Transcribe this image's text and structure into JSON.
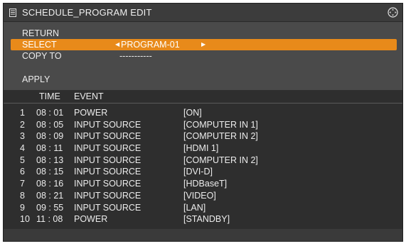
{
  "title": "SCHEDULE_PROGRAM EDIT",
  "colors": {
    "selection": "#e88a1a",
    "panel": "#4a4a4a",
    "table": "#2e2e2e"
  },
  "menu": {
    "return_label": "RETURN",
    "select_label": "SELECT",
    "select_value": "PROGRAM-01",
    "copy_label": "COPY TO",
    "copy_value": "-----------",
    "apply_label": "APPLY"
  },
  "table": {
    "headers": {
      "time": "TIME",
      "event": "EVENT"
    },
    "rows": [
      {
        "num": "1",
        "time": "08 : 01",
        "event": "POWER",
        "param": "[ON]"
      },
      {
        "num": "2",
        "time": "08 : 05",
        "event": "INPUT SOURCE",
        "param": "[COMPUTER IN 1]"
      },
      {
        "num": "3",
        "time": "08 : 09",
        "event": "INPUT SOURCE",
        "param": "[COMPUTER IN 2]"
      },
      {
        "num": "4",
        "time": "08 : 11",
        "event": "INPUT SOURCE",
        "param": "[HDMI 1]"
      },
      {
        "num": "5",
        "time": "08 : 13",
        "event": "INPUT SOURCE",
        "param": "[COMPUTER IN 2]"
      },
      {
        "num": "6",
        "time": "08 : 15",
        "event": "INPUT SOURCE",
        "param": "[DVI-D]"
      },
      {
        "num": "7",
        "time": "08 : 16",
        "event": "INPUT SOURCE",
        "param": "[HDBaseT]"
      },
      {
        "num": "8",
        "time": "08 : 21",
        "event": "INPUT SOURCE",
        "param": "[VIDEO]"
      },
      {
        "num": "9",
        "time": "09 : 55",
        "event": "INPUT SOURCE",
        "param": "[LAN]"
      },
      {
        "num": "10",
        "time": "11 : 08",
        "event": "POWER",
        "param": "[STANDBY]"
      }
    ]
  }
}
